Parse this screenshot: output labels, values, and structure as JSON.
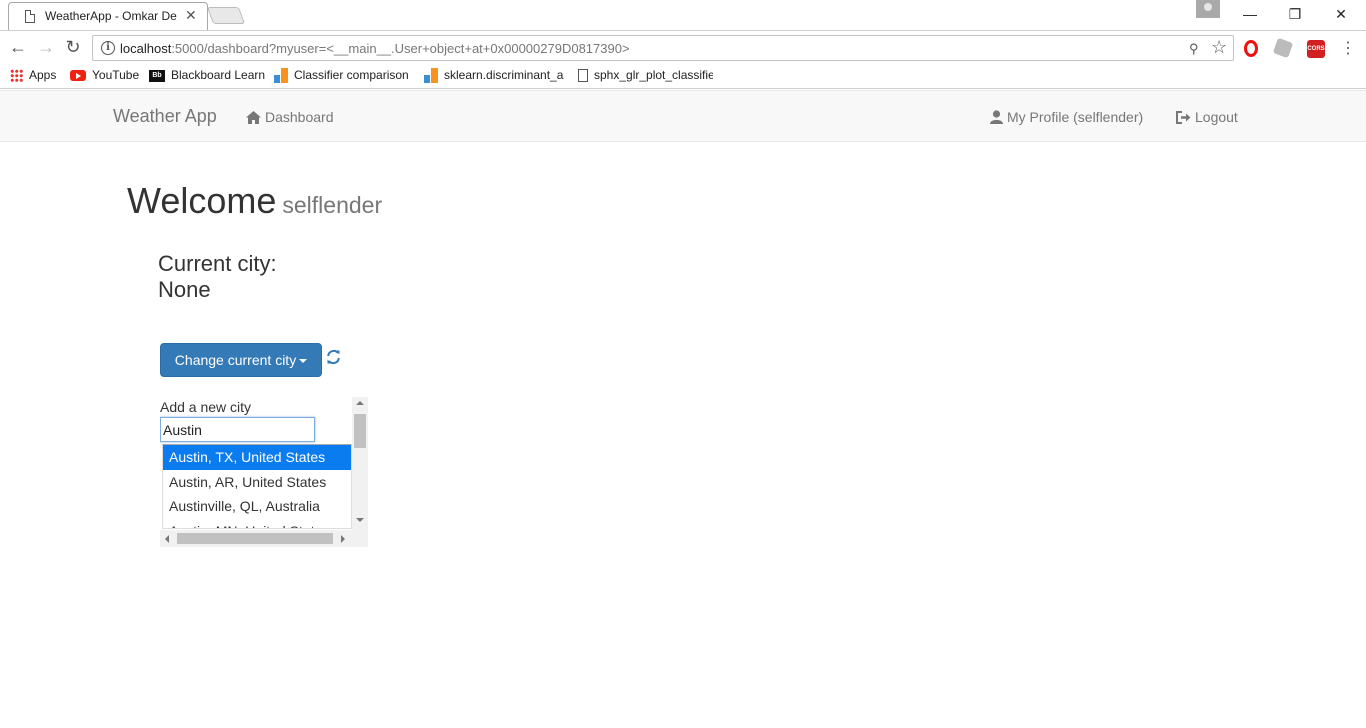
{
  "browser": {
    "tab_title": "WeatherApp - Omkar De",
    "url_host": "localhost",
    "url_path": ":5000/dashboard?myuser=<__main__.User+object+at+0x00000279D0817390>",
    "bookmarks": [
      {
        "label": "Apps",
        "icon": "apps-grid-icon"
      },
      {
        "label": "YouTube",
        "icon": "youtube-icon"
      },
      {
        "label": "Blackboard Learn",
        "icon": "blackboard-icon"
      },
      {
        "label": "Classifier comparison",
        "icon": "sklearn-icon"
      },
      {
        "label": "sklearn.discriminant_a",
        "icon": "sklearn-icon"
      },
      {
        "label": "sphx_glr_plot_classifie",
        "icon": "document-icon"
      }
    ],
    "extensions": [
      "opera-icon",
      "extension-icon",
      "cors-icon"
    ],
    "cors_label": "CORS"
  },
  "navbar": {
    "brand": "Weather App",
    "dashboard": "Dashboard",
    "profile": "My Profile (selflender)",
    "logout": "Logout"
  },
  "main": {
    "welcome": "Welcome",
    "username": "selflender",
    "current_city_label": "Current city:",
    "current_city_value": "None",
    "change_city_button": "Change current city",
    "add_city_label": "Add a new city",
    "city_input_value": "Austin",
    "suggestions": [
      "Austin, TX, United States",
      "Austin, AR, United States",
      "Austinville, QL, Australia",
      "Austin, MN, United States"
    ],
    "selected_suggestion_index": 0
  },
  "colors": {
    "primary_button": "#337ab7",
    "selected_item": "#0a7cf0",
    "navbar_bg": "#f8f8f8"
  }
}
